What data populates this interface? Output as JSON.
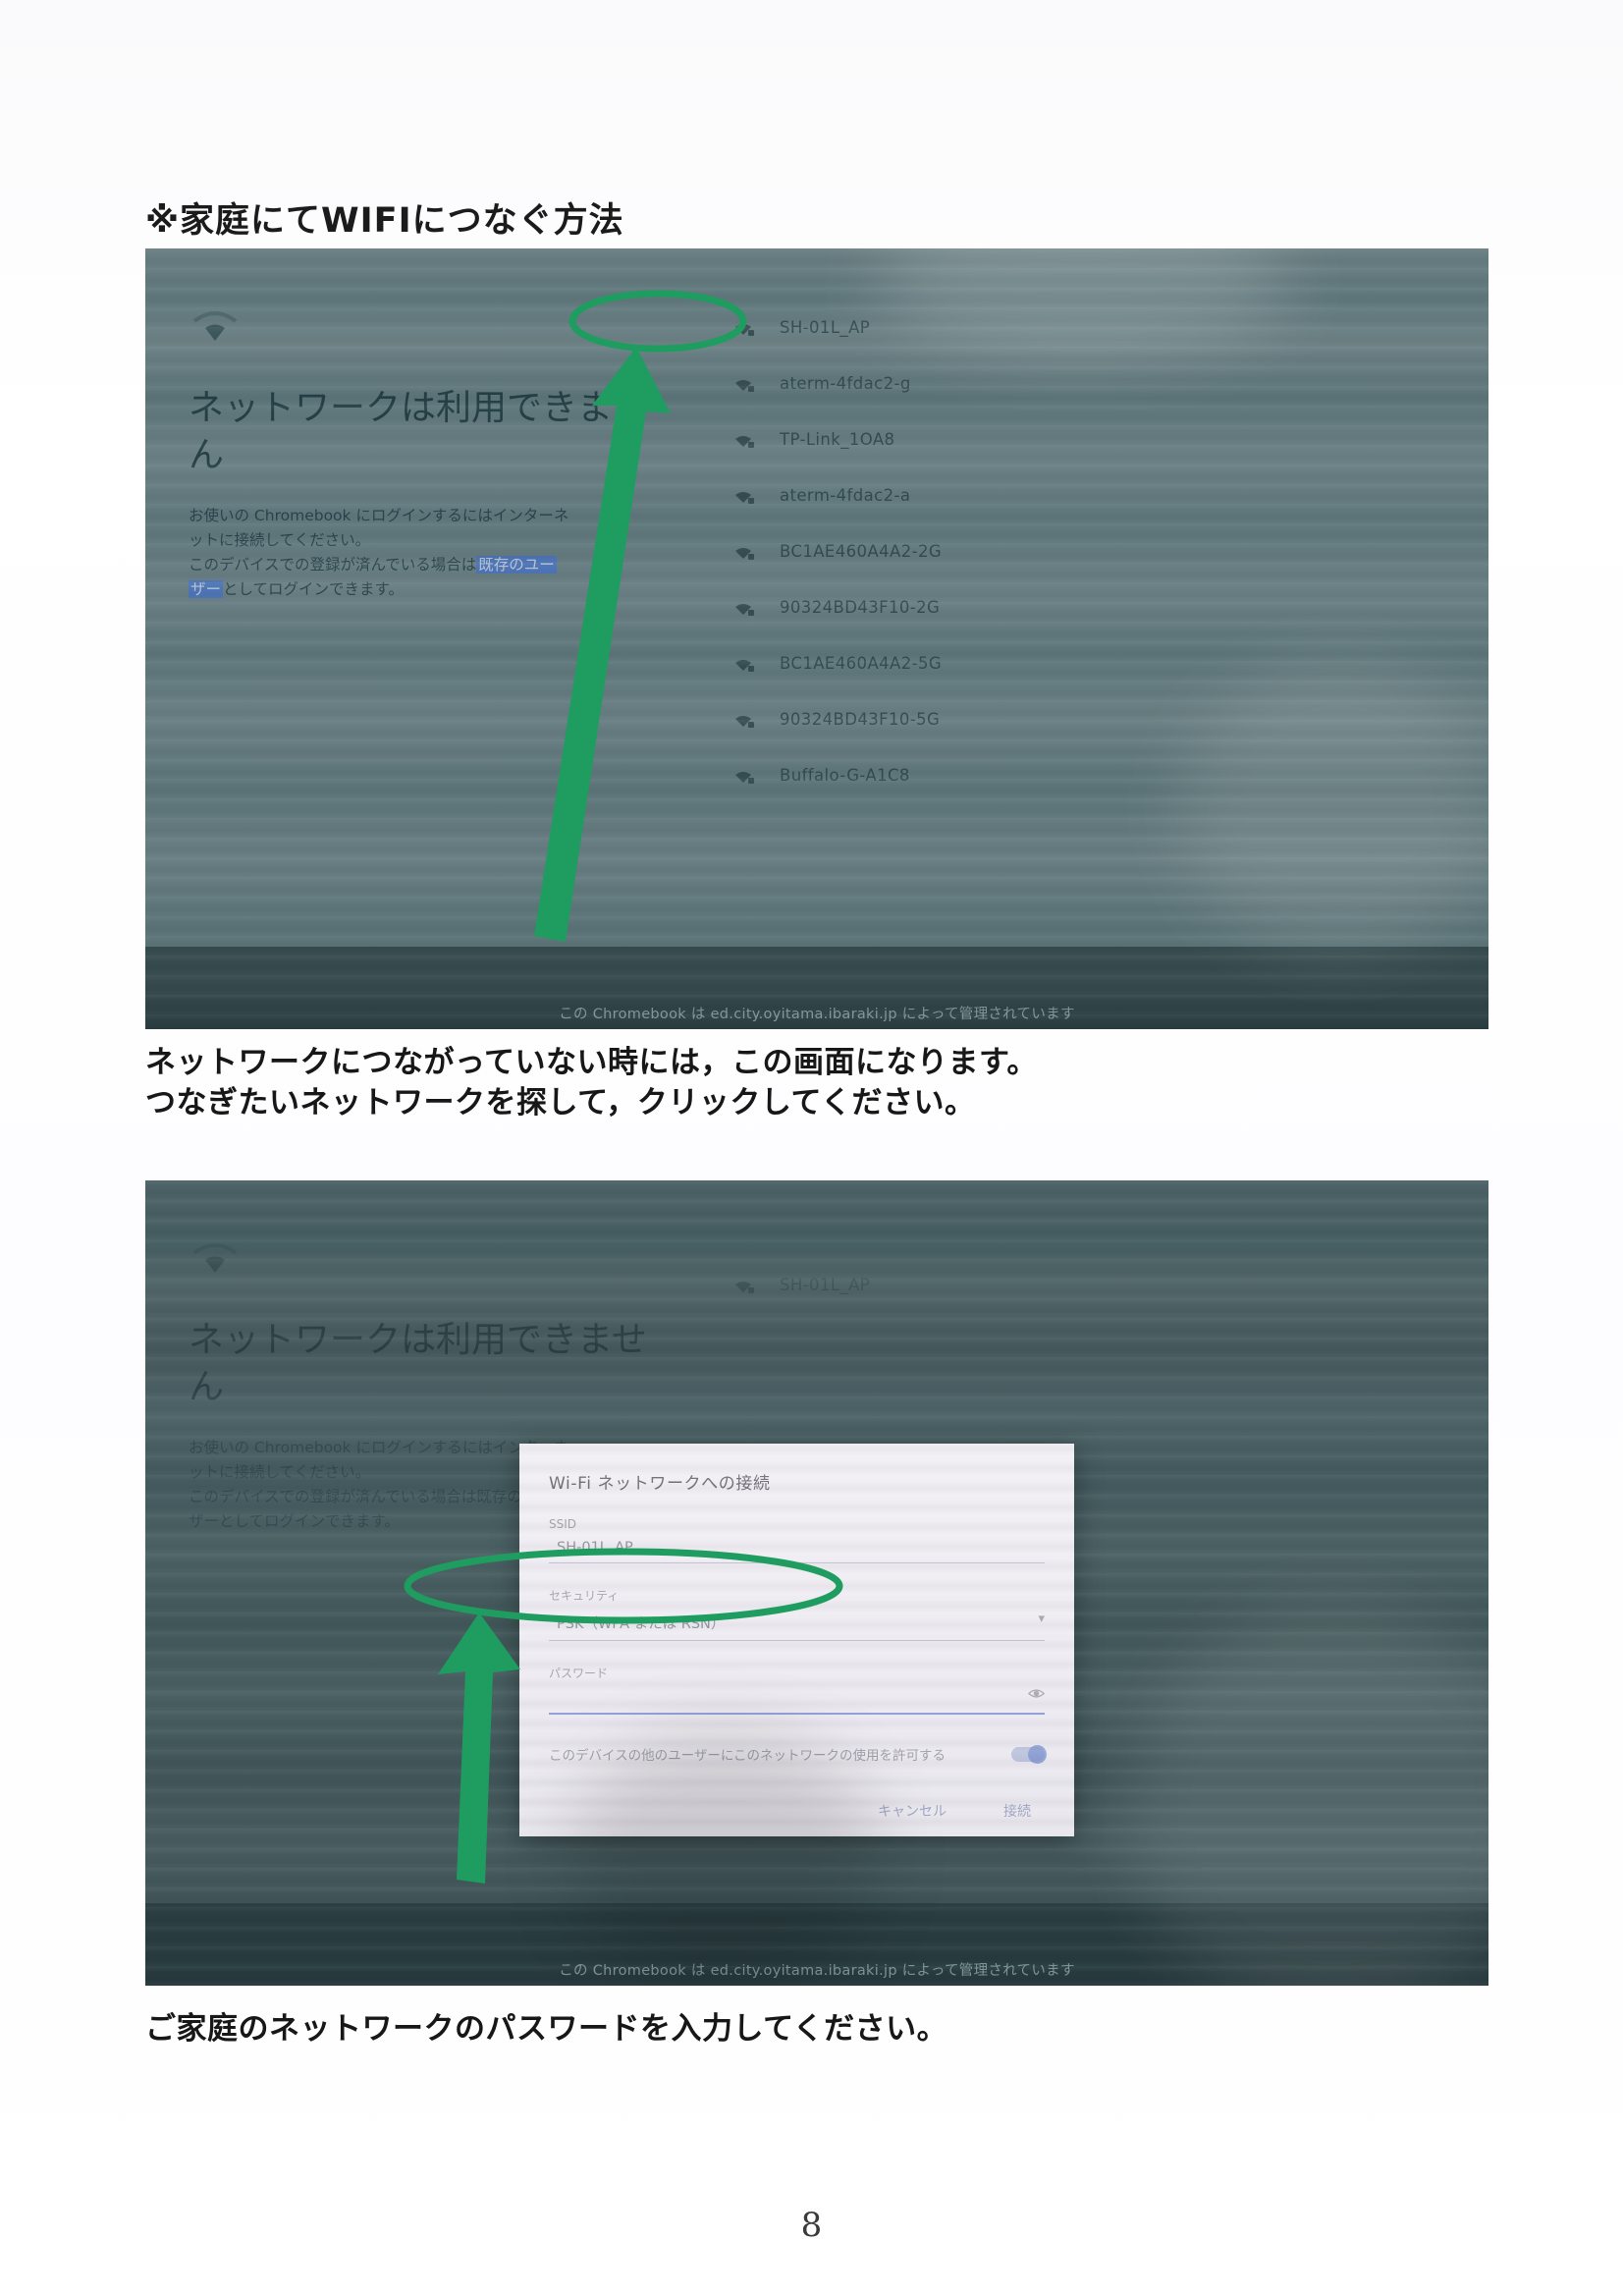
{
  "document": {
    "title": "※家庭にてWIFIにつなぐ方法",
    "page_number": "8"
  },
  "colors": {
    "marker_green": "#1f9d61",
    "screen_teal": "#5f777c",
    "link_blue": "#3f6fd8"
  },
  "screenshot_1": {
    "left_panel": {
      "wifi_icon": "wifi-icon",
      "heading": "ネットワークは利用できません",
      "body_line_1": "お使いの Chromebook にログインするにはインターネ",
      "body_line_2": "ットに接続してください。",
      "body_line_3_pre": "このデバイスでの登録が済んでいる場合は",
      "body_line_3_link": "既存のユー",
      "body_line_4_link": "ザー",
      "body_line_4_post": "としてログインできます。"
    },
    "network_list": [
      {
        "ssid": "SH-01L_AP",
        "icon": "wifi-locked-icon",
        "highlighted": true
      },
      {
        "ssid": "aterm-4fdac2-g",
        "icon": "wifi-locked-icon",
        "highlighted": false
      },
      {
        "ssid": "TP-Link_1OA8",
        "icon": "wifi-locked-icon",
        "highlighted": false
      },
      {
        "ssid": "aterm-4fdac2-a",
        "icon": "wifi-locked-icon",
        "highlighted": false
      },
      {
        "ssid": "BC1AE460A4A2-2G",
        "icon": "wifi-locked-icon",
        "highlighted": false
      },
      {
        "ssid": "90324BD43F10-2G",
        "icon": "wifi-locked-icon",
        "highlighted": false
      },
      {
        "ssid": "BC1AE460A4A2-5G",
        "icon": "wifi-locked-icon",
        "highlighted": false
      },
      {
        "ssid": "90324BD43F10-5G",
        "icon": "wifi-locked-icon",
        "highlighted": false
      },
      {
        "ssid": "Buffalo-G-A1C8",
        "icon": "wifi-locked-icon",
        "highlighted": false
      }
    ],
    "managed_notice": "この Chromebook は ed.city.oyitama.ibaraki.jp によって管理されています",
    "annotation": {
      "ellipse_target": "SH-01L_AP",
      "arrow": "arrow-pointing-up-to-network-name"
    }
  },
  "caption_1": {
    "line_1": "ネットワークにつながっていない時には，この画面になります。",
    "line_2": "つなぎたいネットワークを探して，クリックしてください。"
  },
  "screenshot_2": {
    "left_panel": {
      "heading": "ネットワークは利用できません",
      "body_line_1": "お使いの Chromebook にログインするにはインターネ",
      "body_line_2": "ットに接続してください。",
      "body_line_3": "このデバイスでの登録が済んでいる場合は既存のユー",
      "body_line_4": "ザーとしてログインできます。"
    },
    "background_network": "SH-01L_AP",
    "dialog": {
      "title": "Wi-Fi ネットワークへの接続",
      "ssid_label": "SSID",
      "ssid_value": "SH-01L_AP",
      "security_label": "セキュリティ",
      "security_value": "PSK（WPA または RSN）",
      "password_label": "パスワード",
      "password_value": "",
      "password_reveal_icon": "eye-icon",
      "allow_others_label": "このデバイスの他のユーザーにこのネットワークの使用を許可する",
      "allow_others_toggle": "on",
      "cancel_button": "キャンセル",
      "connect_button": "接続"
    },
    "managed_notice": "この Chromebook は ed.city.oyitama.ibaraki.jp によって管理されています",
    "annotation": {
      "ellipse_target": "パスワード入力欄",
      "arrow": "arrow-pointing-up-to-password-field"
    }
  },
  "caption_2": {
    "line_1": "ご家庭のネットワークのパスワードを入力してください。"
  }
}
